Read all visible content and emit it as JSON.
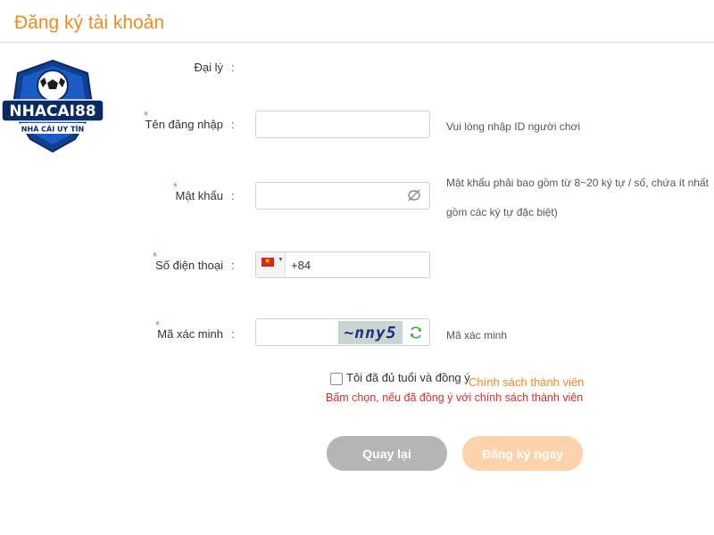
{
  "page": {
    "title": "Đăng ký tài khoản"
  },
  "logo": {
    "brand": "NHACAI88",
    "tagline": "NHÀ CÁI UY TÍN"
  },
  "form": {
    "agent": {
      "label": "Đại lý",
      "colon": ":"
    },
    "username": {
      "label": "Tên đăng nhập",
      "colon": ":",
      "required": "*",
      "value": "",
      "hint": "Vui lòng nhập ID người chơi"
    },
    "password": {
      "label": "Mật khẩu",
      "colon": ":",
      "required": "*",
      "value": "",
      "hint_line1": "Mật khẩu phải bao gồm từ 8~20 ký tự / số, chứa ít nhất",
      "hint_line2": "gồm các ký tự đặc biệt)"
    },
    "phone": {
      "label": "Số điện thoại",
      "colon": ":",
      "required": "*",
      "country_code": "+84",
      "value": ""
    },
    "captcha": {
      "label": "Mã xác minh",
      "colon": ":",
      "required": "*",
      "value": "",
      "code": "~nny5",
      "hint": "Mã xác minh"
    },
    "agree": {
      "text": "Tôi đã đủ tuổi và đồng ý",
      "link": "Chính sách thành viên",
      "checked": false,
      "error": "Bấm chọn, nếu đã đồng ý với chính sách thành viên"
    }
  },
  "buttons": {
    "back": "Quay lại",
    "register": "Đăng ký ngay"
  },
  "colors": {
    "accent": "#f08a1c",
    "error": "#e02a2a",
    "back_button": "#b5b5b5",
    "register_button": "#fcd2ab"
  }
}
